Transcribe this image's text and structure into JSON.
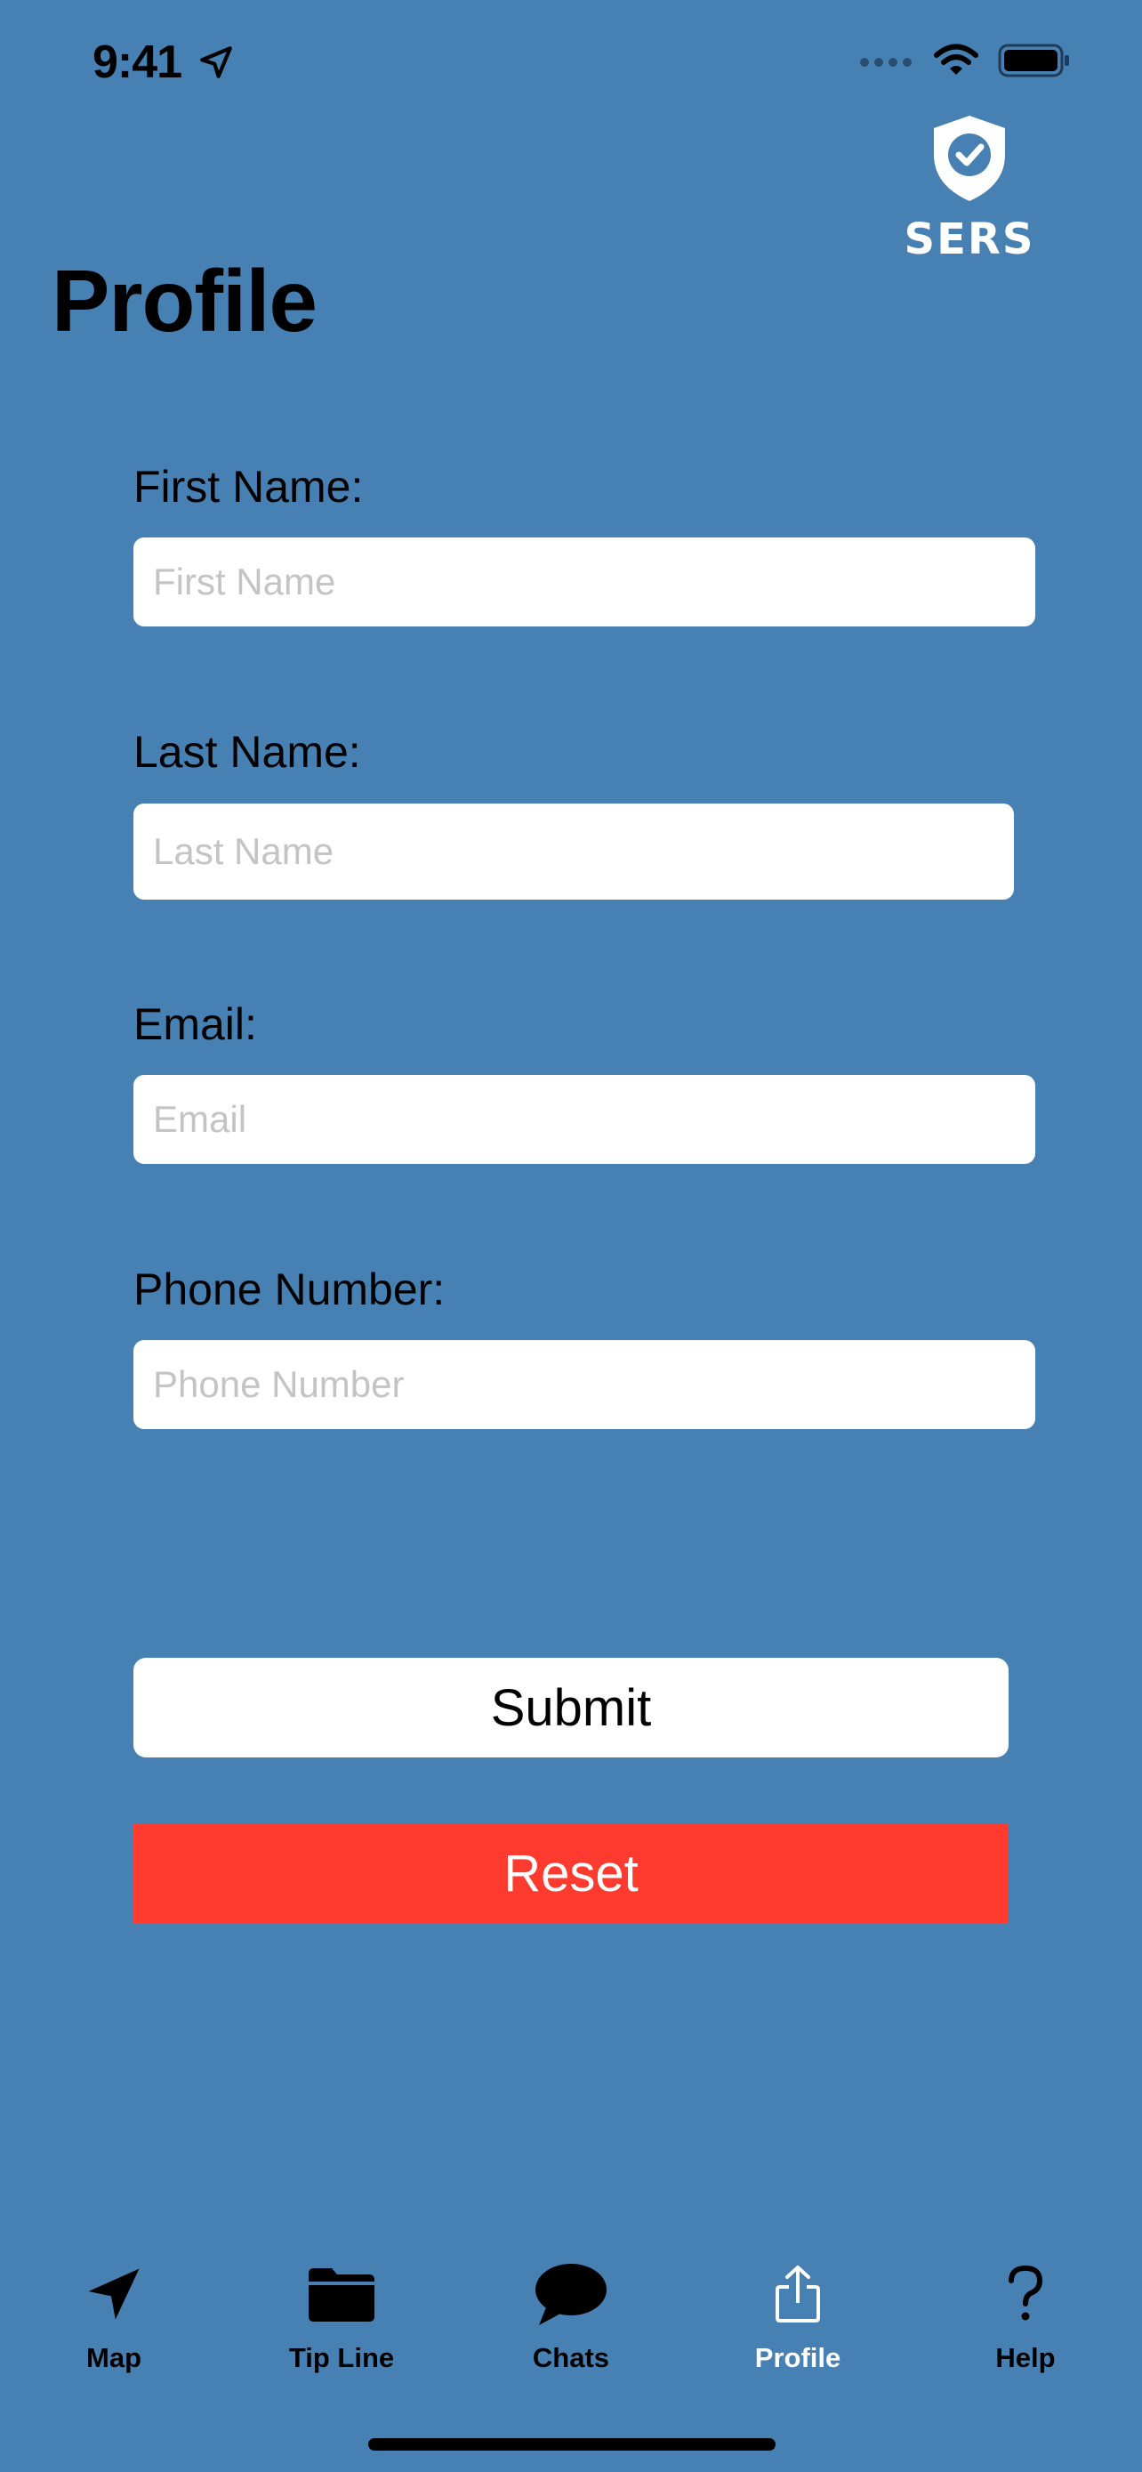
{
  "status_bar": {
    "time": "9:41"
  },
  "logo": {
    "text": "SERS"
  },
  "page": {
    "title": "Profile"
  },
  "form": {
    "first_name": {
      "label": "First Name:",
      "placeholder": "First Name",
      "value": ""
    },
    "last_name": {
      "label": "Last Name:",
      "placeholder": "Last Name",
      "value": ""
    },
    "email": {
      "label": "Email:",
      "placeholder": "Email",
      "value": ""
    },
    "phone": {
      "label": "Phone Number:",
      "placeholder": "Phone Number",
      "value": ""
    }
  },
  "actions": {
    "submit_label": "Submit",
    "reset_label": "Reset"
  },
  "tabs": [
    {
      "label": "Map",
      "icon": "location-arrow-icon"
    },
    {
      "label": "Tip Line",
      "icon": "folder-icon"
    },
    {
      "label": "Chats",
      "icon": "chat-bubble-icon"
    },
    {
      "label": "Profile",
      "icon": "share-icon",
      "active": true
    },
    {
      "label": "Help",
      "icon": "question-mark-icon"
    }
  ],
  "colors": {
    "background": "#4780b3",
    "reset": "#ff3b30",
    "active_tab": "#ffffff"
  }
}
